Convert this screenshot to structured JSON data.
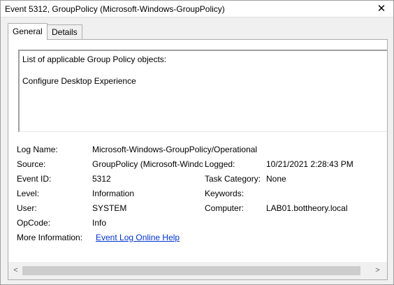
{
  "window": {
    "title": "Event 5312, GroupPolicy (Microsoft-Windows-GroupPolicy)",
    "close_glyph": "✕"
  },
  "tabs": [
    {
      "label": "General",
      "active": true
    },
    {
      "label": "Details",
      "active": false
    }
  ],
  "description": {
    "line1": "List of applicable Group Policy objects:",
    "line2": "Configure Desktop Experience"
  },
  "properties": {
    "log_name": {
      "label": "Log Name:",
      "value": "Microsoft-Windows-GroupPolicy/Operational"
    },
    "source": {
      "label": "Source:",
      "value": "GroupPolicy (Microsoft-Windows-GroupPolicy)"
    },
    "logged": {
      "label": "Logged:",
      "value": "10/21/2021 2:28:43 PM"
    },
    "event_id": {
      "label": "Event ID:",
      "value": "5312"
    },
    "task_category": {
      "label": "Task Category:",
      "value": "None"
    },
    "level": {
      "label": "Level:",
      "value": "Information"
    },
    "keywords": {
      "label": "Keywords:",
      "value": ""
    },
    "user": {
      "label": "User:",
      "value": "SYSTEM"
    },
    "computer": {
      "label": "Computer:",
      "value": "LAB01.bottheory.local"
    },
    "opcode": {
      "label": "OpCode:",
      "value": "Info"
    },
    "more_info": {
      "label": "More Information:",
      "link": "Event Log Online Help"
    }
  },
  "scrollbar": {
    "left_arrow": "<",
    "right_arrow": ">"
  }
}
